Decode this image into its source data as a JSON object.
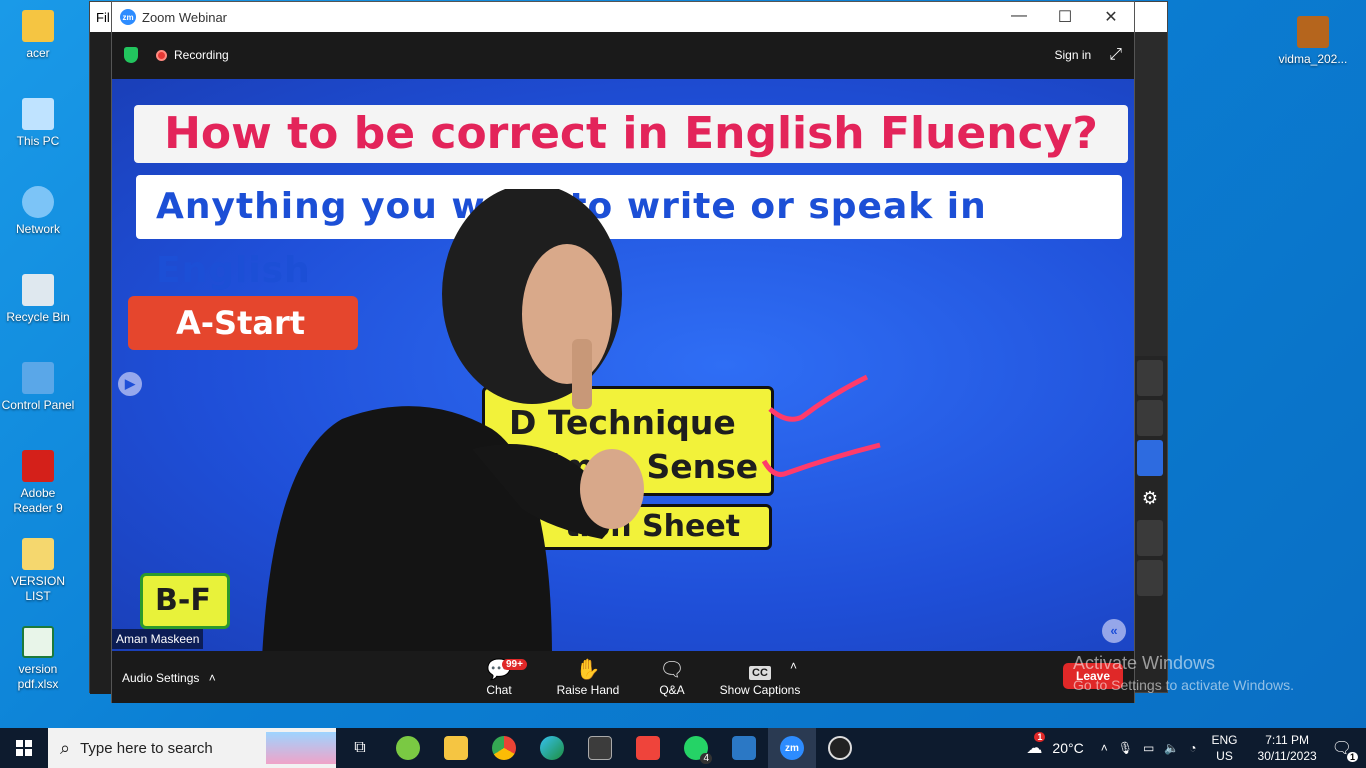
{
  "desktop": {
    "icons": [
      {
        "label": "acer"
      },
      {
        "label": "This PC"
      },
      {
        "label": "Network"
      },
      {
        "label": "Recycle Bin"
      },
      {
        "label": "Control Panel"
      },
      {
        "label": "Adobe Reader 9"
      },
      {
        "label": "VERSION LIST"
      },
      {
        "label": "version pdf.xlsx"
      },
      {
        "label": "vidma_202..."
      }
    ]
  },
  "bg_app": {
    "menu_label": "Fil"
  },
  "zoom": {
    "title": "Zoom Webinar",
    "logo_text": "zm",
    "recording_label": "Recording",
    "sign_in_label": "Sign in",
    "speaker_name": "Aman Maskeen",
    "video": {
      "banner_title": "How to be correct in English Fluency?",
      "banner_subtitle": "Anything you want to write or speak in English",
      "a_start": "A-Start",
      "box1_line1": "D Technique",
      "box1_line2": "im & Sense",
      "box2": "tion Sheet",
      "b_label": "B-F",
      "handwriting": "2 S"
    },
    "toolbar": {
      "audio_settings": "Audio Settings",
      "chat": "Chat",
      "chat_badge": "99+",
      "raise_hand": "Raise Hand",
      "qa": "Q&A",
      "show_captions": "Show Captions",
      "cc_label": "CC",
      "leave": "Leave"
    }
  },
  "watermark": {
    "line1": "Activate Windows",
    "line2": "Go to Settings to activate Windows."
  },
  "taskbar": {
    "search_placeholder": "Type here to search",
    "whatsapp_badge": "4",
    "zoom_label": "zm",
    "temperature": "20°C",
    "weather_badge": "1",
    "lang_line1": "ENG",
    "lang_line2": "US",
    "time": "7:11 PM",
    "date": "30/11/2023",
    "notification_count": "1"
  }
}
